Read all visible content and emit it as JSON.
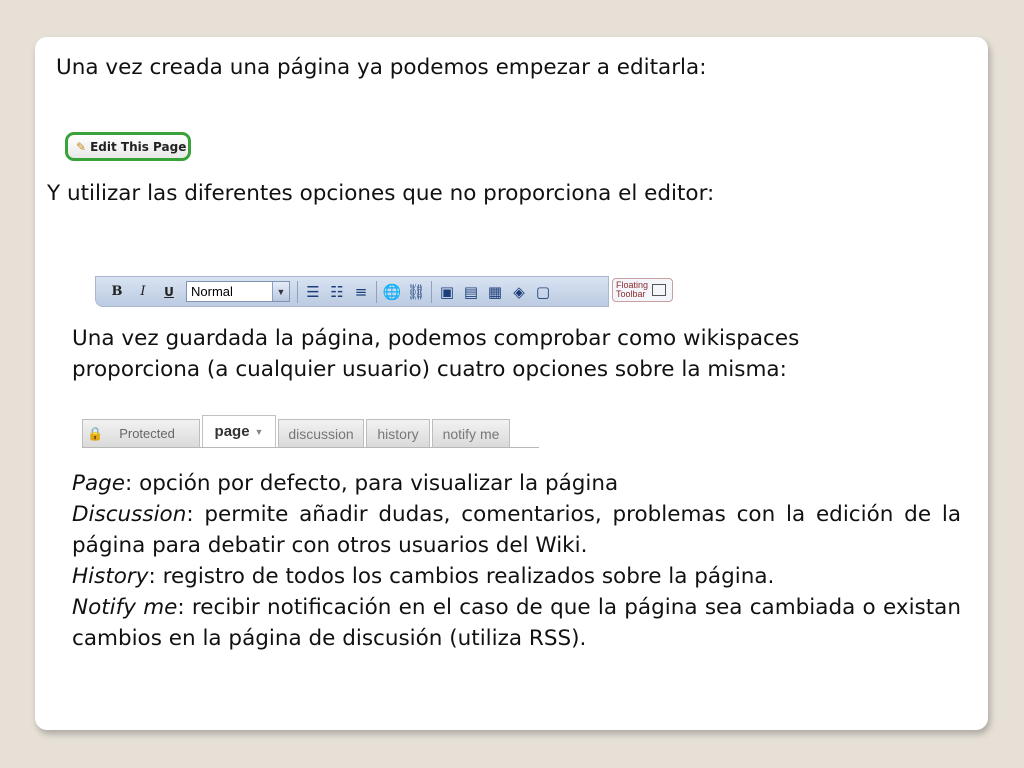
{
  "slide": {
    "intro": "Una vez creada una página ya podemos empezar a editarla:",
    "options_line": "Y utilizar las diferentes opciones que no proporciona el editor:",
    "saved_line_1": "Una vez guardada la página, podemos comprobar como wikispaces",
    "saved_line_2": "proporciona (a cualquier usuario) cuatro opciones sobre la misma:"
  },
  "edit_button": {
    "label": "Edit This Page",
    "icon": "pencil-icon"
  },
  "toolbar": {
    "bold": "B",
    "italic": "I",
    "underline": "U",
    "format_select": "Normal",
    "floating_label_1": "Floating",
    "floating_label_2": "Toolbar"
  },
  "tabs": {
    "protected": "Protected",
    "page": "page",
    "discussion": "discussion",
    "history": "history",
    "notify": "notify me"
  },
  "descriptions": {
    "page_term": "Page",
    "page_text": ": opción por defecto, para visualizar la página",
    "discussion_term": "Discussion",
    "discussion_text": ": permite añadir dudas, comentarios, problemas con la edición de la página para debatir con otros usuarios del Wiki.",
    "history_term": "History",
    "history_text": ": registro de todos los cambios realizados sobre la página.",
    "notify_term": "Notify me",
    "notify_text": ": recibir notificación en el caso de que la página sea cambiada o existan cambios en la página de discusión (utiliza RSS)."
  }
}
